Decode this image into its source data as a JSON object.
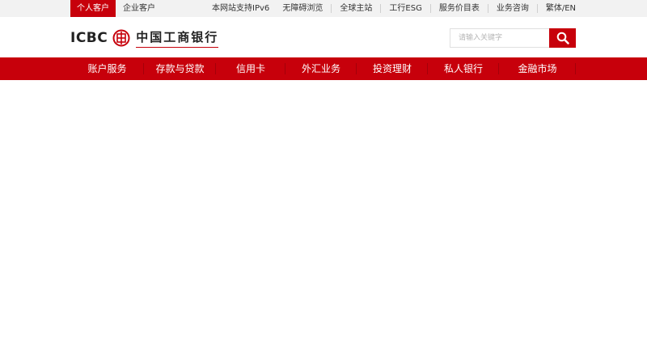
{
  "topbar": {
    "tab_personal": "个人客户",
    "tab_corporate": "企业客户",
    "ipv6_notice": "本网站支持IPv6",
    "links": [
      "无障碍浏览",
      "全球主站",
      "工行ESG",
      "服务价目表",
      "业务咨询",
      "繁体/EN"
    ]
  },
  "header": {
    "logo_latin": "ICBC",
    "logo_chinese": "中国工商银行",
    "search_placeholder": "请输入关键字"
  },
  "nav": {
    "items": [
      "账户服务",
      "存款与贷款",
      "信用卡",
      "外汇业务",
      "投资理财",
      "私人银行",
      "金融市场"
    ]
  },
  "colors": {
    "brand_red": "#c7000b",
    "topbar_bg": "#f2f2f2"
  }
}
